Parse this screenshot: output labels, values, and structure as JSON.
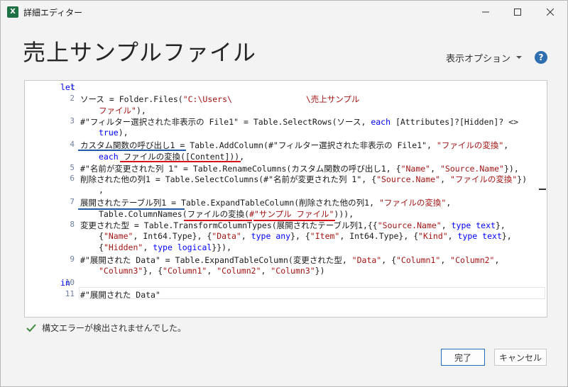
{
  "window": {
    "title": "詳細エディター",
    "app_icon_letter": "X"
  },
  "header": {
    "query_name": "売上サンプルファイル",
    "display_options_label": "表示オプション",
    "help_label": "?"
  },
  "editor": {
    "line_numbers": [
      "1",
      "2",
      "3",
      "4",
      "5",
      "6",
      "7",
      "8",
      "9",
      "10",
      "11"
    ],
    "code_lines": [
      [
        {
          "t": "let",
          "c": "kw"
        }
      ],
      [
        {
          "t": "ソース = Folder.Files(",
          "c": ""
        },
        {
          "t": "\"C:\\Users\\",
          "c": "str"
        },
        {
          "t": "               ",
          "c": ""
        },
        {
          "t": "\\売上サンプル",
          "c": "str"
        }
      ],
      [
        {
          "t": "ファイル\"",
          "c": "str"
        },
        {
          "t": "),",
          "c": ""
        }
      ],
      [
        {
          "t": "#\"フィルター選択された非表示の File1\" = Table.SelectRows(ソース, ",
          "c": ""
        },
        {
          "t": "each",
          "c": "kw"
        },
        {
          "t": " [Attributes]?[Hidden]? <>",
          "c": ""
        }
      ],
      [
        {
          "t": "true",
          "c": "kw"
        },
        {
          "t": "),",
          "c": ""
        }
      ],
      [
        {
          "t": "カスタム関数の呼び出し1 = Table.AddColumn(#\"フィルター選択された非表示の File1\", ",
          "c": ""
        },
        {
          "t": "\"ファイルの変換\"",
          "c": "str"
        },
        {
          "t": ",",
          "c": ""
        }
      ],
      [
        {
          "t": "each",
          "c": "kw"
        },
        {
          "t": " ファイルの変換([Content])),",
          "c": ""
        }
      ],
      [
        {
          "t": "#\"名前が変更された列 1\" = Table.RenameColumns(カスタム関数の呼び出し1, {",
          "c": ""
        },
        {
          "t": "\"Name\"",
          "c": "str"
        },
        {
          "t": ", ",
          "c": ""
        },
        {
          "t": "\"Source.Name\"",
          "c": "str"
        },
        {
          "t": "}),",
          "c": ""
        }
      ],
      [
        {
          "t": "削除された他の列1 = Table.SelectColumns(#\"名前が変更された列 1\", {",
          "c": ""
        },
        {
          "t": "\"Source.Name\"",
          "c": "str"
        },
        {
          "t": ", ",
          "c": ""
        },
        {
          "t": "\"ファイルの変換\"",
          "c": "str"
        },
        {
          "t": "})",
          "c": ""
        }
      ],
      [
        {
          "t": ",",
          "c": ""
        }
      ],
      [
        {
          "t": "展開されたテーブル列1 = Table.ExpandTableColumn(削除された他の列1, ",
          "c": ""
        },
        {
          "t": "\"ファイルの変換\"",
          "c": "str"
        },
        {
          "t": ",",
          "c": ""
        }
      ],
      [
        {
          "t": "Table.ColumnNames(ファイルの変換(",
          "c": ""
        },
        {
          "t": "#\"サンプル ファイル\"",
          "c": "str"
        },
        {
          "t": "))),",
          "c": ""
        }
      ],
      [
        {
          "t": "変更された型 = Table.TransformColumnTypes(展開されたテーブル列1,{{",
          "c": ""
        },
        {
          "t": "\"Source.Name\"",
          "c": "str"
        },
        {
          "t": ", ",
          "c": ""
        },
        {
          "t": "type",
          "c": "kw"
        },
        {
          "t": " ",
          "c": ""
        },
        {
          "t": "text",
          "c": "kw"
        },
        {
          "t": "},",
          "c": ""
        }
      ],
      [
        {
          "t": "{",
          "c": ""
        },
        {
          "t": "\"Name\"",
          "c": "str"
        },
        {
          "t": ", Int64.Type}, {",
          "c": ""
        },
        {
          "t": "\"Data\"",
          "c": "str"
        },
        {
          "t": ", ",
          "c": ""
        },
        {
          "t": "type",
          "c": "kw"
        },
        {
          "t": " ",
          "c": ""
        },
        {
          "t": "any",
          "c": "kw"
        },
        {
          "t": "}, {",
          "c": ""
        },
        {
          "t": "\"Item\"",
          "c": "str"
        },
        {
          "t": ", Int64.Type}, {",
          "c": ""
        },
        {
          "t": "\"Kind\"",
          "c": "str"
        },
        {
          "t": ", ",
          "c": ""
        },
        {
          "t": "type",
          "c": "kw"
        },
        {
          "t": " ",
          "c": ""
        },
        {
          "t": "text",
          "c": "kw"
        },
        {
          "t": "},",
          "c": ""
        }
      ],
      [
        {
          "t": "{",
          "c": ""
        },
        {
          "t": "\"Hidden\"",
          "c": "str"
        },
        {
          "t": ", ",
          "c": ""
        },
        {
          "t": "type",
          "c": "kw"
        },
        {
          "t": " ",
          "c": ""
        },
        {
          "t": "logical",
          "c": "kw"
        },
        {
          "t": "}}),",
          "c": ""
        }
      ],
      [
        {
          "t": "#\"展開された Data\" = Table.ExpandTableColumn(変更された型, ",
          "c": ""
        },
        {
          "t": "\"Data\"",
          "c": "str"
        },
        {
          "t": ", {",
          "c": ""
        },
        {
          "t": "\"Column1\"",
          "c": "str"
        },
        {
          "t": ", ",
          "c": ""
        },
        {
          "t": "\"Column2\"",
          "c": "str"
        },
        {
          "t": ",",
          "c": ""
        }
      ],
      [
        {
          "t": "\"Column3\"",
          "c": "str"
        },
        {
          "t": "}, {",
          "c": ""
        },
        {
          "t": "\"Column1\"",
          "c": "str"
        },
        {
          "t": ", ",
          "c": ""
        },
        {
          "t": "\"Column2\"",
          "c": "str"
        },
        {
          "t": ", ",
          "c": ""
        },
        {
          "t": "\"Column3\"",
          "c": "str"
        },
        {
          "t": "})",
          "c": ""
        }
      ],
      [
        {
          "t": "in",
          "c": "kw"
        }
      ],
      [
        {
          "t": "#\"展開された Data\"",
          "c": ""
        }
      ]
    ]
  },
  "status": {
    "message": "構文エラーが検出されませんでした。"
  },
  "buttons": {
    "ok_label": "完了",
    "cancel_label": "キャンセル"
  },
  "colors": {
    "keyword": "#0000ff",
    "string": "#a31515",
    "line_number": "#6e7fa0",
    "annotation_blue": "#1f5aa6",
    "annotation_red": "#d4141b",
    "success_check": "#3c8a3c",
    "excel_green": "#1e7145"
  }
}
